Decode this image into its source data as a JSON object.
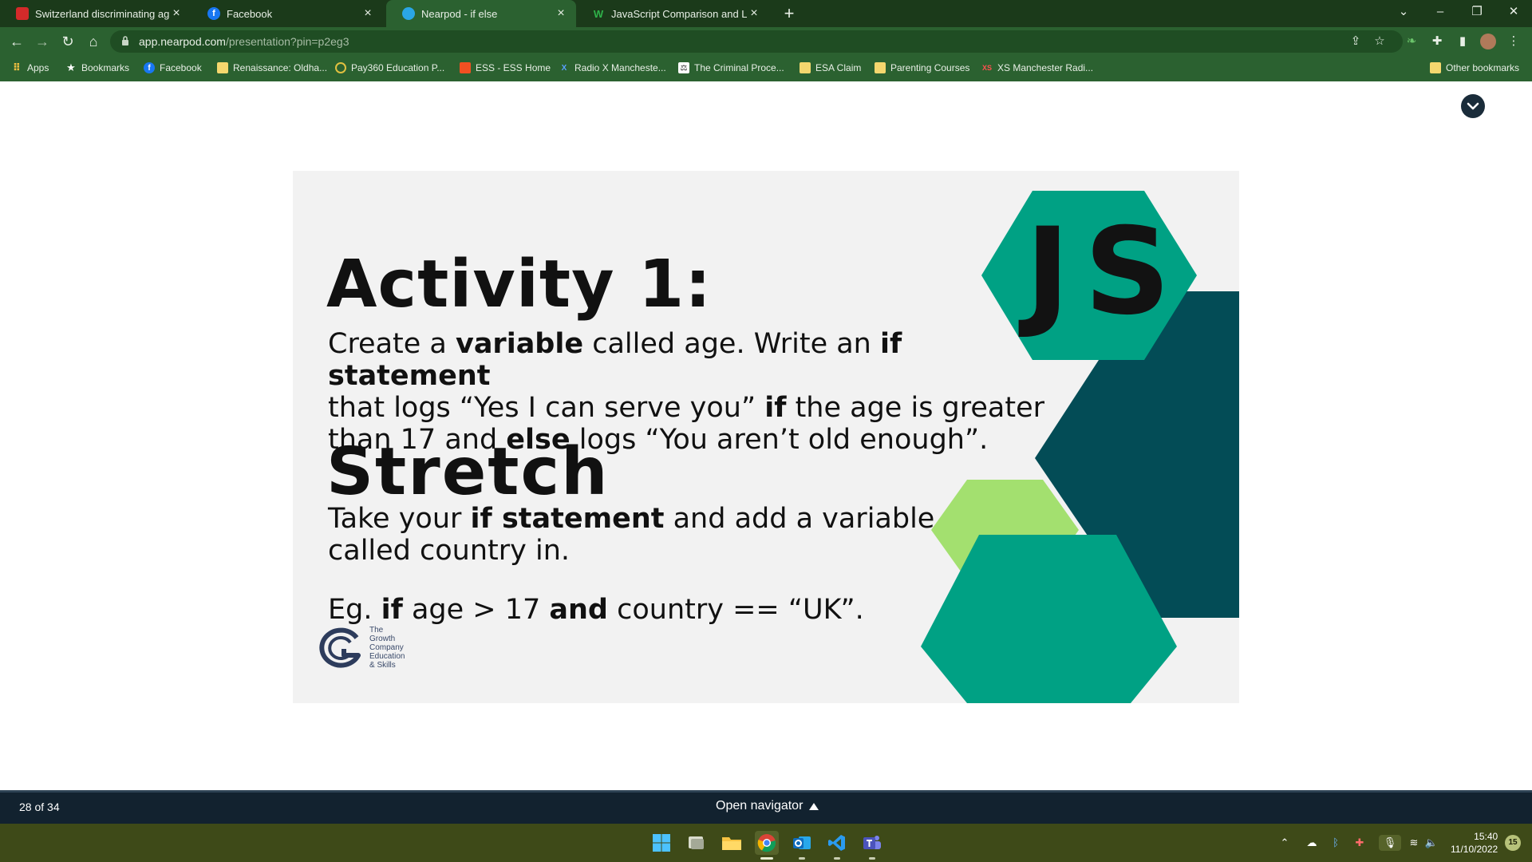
{
  "browser": {
    "tabs": [
      {
        "title": "Switzerland discriminating against",
        "active": false
      },
      {
        "title": "Facebook",
        "active": false
      },
      {
        "title": "Nearpod - if else",
        "active": true
      },
      {
        "title": "JavaScript Comparison and Logic",
        "active": false
      }
    ],
    "url_host": "app.nearpod.com",
    "url_path": "/presentation?pin=p2eg3",
    "bookmarks": [
      "Apps",
      "Bookmarks",
      "Facebook",
      "Renaissance: Oldha...",
      "Pay360 Education P...",
      "ESS - ESS Home",
      "Radio X Mancheste...",
      "The Criminal Proce...",
      "ESA Claim",
      "Parenting Courses",
      "XS Manchester Radi..."
    ],
    "other_bookmarks": "Other bookmarks"
  },
  "slide": {
    "heading": "Activity 1:",
    "para1": {
      "l1a": "Create a ",
      "l1b": "variable",
      "l1c": " called age. Write an ",
      "l1d": "if statement",
      "l2a": "that logs “Yes I can serve you” ",
      "l2b": "if",
      "l2c": " the age is greater",
      "l3a": "than 17 and ",
      "l3b": "else",
      "l3c": " logs “You aren’t old enough”."
    },
    "heading2": "Stretch",
    "para2": {
      "l1a": "Take your ",
      "l1b": "if statement",
      "l1c": " and add a variable",
      "l2": "called country in."
    },
    "example": {
      "a": "Eg. ",
      "b": "if",
      "c": " age > 17 ",
      "d": "and",
      "e": " country == “UK”."
    },
    "js_label": "JS",
    "logo_lines": [
      "The",
      "Growth",
      "Company",
      "Education",
      "& Skills"
    ],
    "colors": {
      "teal": "#00a184",
      "dark_teal": "#034c56",
      "light_green": "#a3e06f"
    }
  },
  "nearpod": {
    "slide_count": "28 of 34",
    "open_navigator": "Open navigator"
  },
  "taskbar": {
    "time": "15:40",
    "date": "11/10/2022",
    "notifications": "15"
  }
}
